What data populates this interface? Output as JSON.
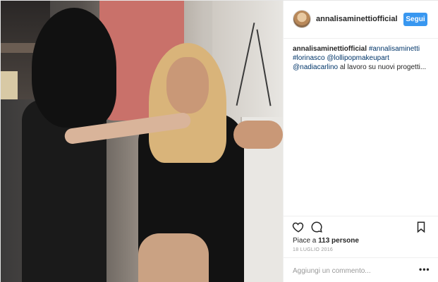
{
  "post": {
    "username": "annalisaminettiofficial",
    "follow_label": "Segui",
    "caption_user": "annalisaminettiofficial",
    "caption_tags": "#annalisaminetti #lorinasco @lollipopmakeupart @nadiacarlino",
    "caption_text": "al lavoro su nuovi progetti...",
    "likes_prefix": "Piace a ",
    "likes_count": "113 persone",
    "date": "18 LUGLIO 2016",
    "comment_placeholder": "Aggiungi un commento...",
    "more_label": "•••"
  },
  "icons": {
    "like": "heart-icon",
    "comment": "comment-icon",
    "save": "bookmark-icon",
    "more": "more-options-icon"
  },
  "colors": {
    "accent": "#3897f0",
    "text": "#262626",
    "muted": "#999999",
    "link": "#003569"
  }
}
